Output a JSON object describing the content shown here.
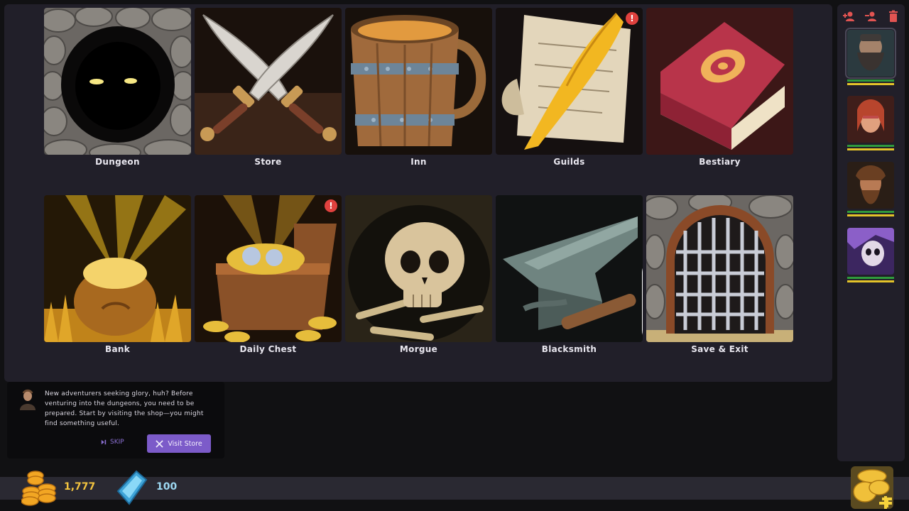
{
  "tiles": [
    {
      "key": "dungeon",
      "label": "Dungeon",
      "badge": false,
      "locked": false
    },
    {
      "key": "store",
      "label": "Store",
      "badge": false,
      "locked": false
    },
    {
      "key": "inn",
      "label": "Inn",
      "badge": false,
      "locked": false
    },
    {
      "key": "guilds",
      "label": "Guilds",
      "badge": true,
      "locked": false
    },
    {
      "key": "bestiary",
      "label": "Bestiary",
      "badge": false,
      "locked": false
    },
    {
      "key": "bank",
      "label": "Bank",
      "badge": false,
      "locked": false
    },
    {
      "key": "daily_chest",
      "label": "Daily Chest",
      "badge": true,
      "locked": false
    },
    {
      "key": "morgue",
      "label": "Morgue",
      "badge": false,
      "locked": false
    },
    {
      "key": "blacksmith",
      "label": "Blacksmith",
      "badge": false,
      "locked": true
    },
    {
      "key": "save_exit",
      "label": "Save & Exit",
      "badge": false,
      "locked": false
    }
  ],
  "badge_glyph": "!",
  "sidebar": {
    "actions": [
      "add-hero-icon",
      "remove-hero-icon",
      "delete-icon"
    ],
    "heroes": [
      {
        "name": "hero-dwarf",
        "selected": true
      },
      {
        "name": "hero-elf-woman",
        "selected": false
      },
      {
        "name": "hero-barbarian",
        "selected": false
      },
      {
        "name": "hero-undead",
        "selected": false
      }
    ],
    "bar_colors": [
      "#2f9a3c",
      "#e3c329"
    ]
  },
  "dialog": {
    "message": "New adventurers seeking glory, huh? Before venturing into the dungeons, you need to be prepared. Start by visiting the shop—you might find something useful.",
    "skip_label": "SKIP",
    "visit_label": "Visit Store"
  },
  "currency": {
    "gold": "1,777",
    "gems": "100"
  },
  "colors": {
    "accent": "#7c5bc9",
    "badge": "#e0413e",
    "gold": "#f3c43f",
    "gem": "#9dd8f2"
  }
}
